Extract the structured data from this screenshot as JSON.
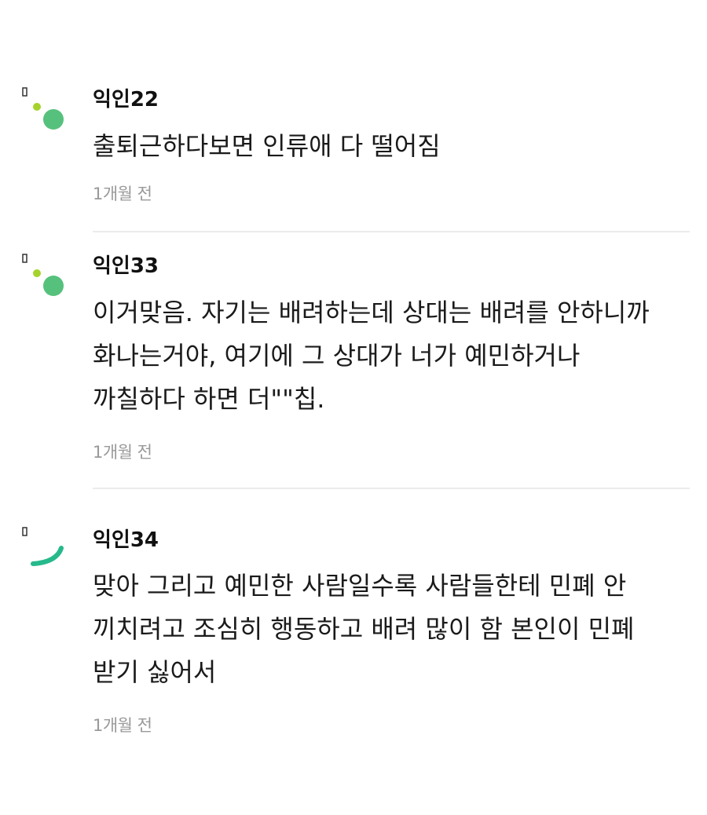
{
  "comments": [
    {
      "author": "익인22",
      "text": "출퇴근하다보면 인류애 다 떨어짐",
      "time": "1개월 전"
    },
    {
      "author": "익인33",
      "text": "이거맞음. 자기는 배려하는데 상대는 배려를 안하니까 화나는거야, 여기에 그 상대가 너가 예민하거나 까칠하다 하면 더\"\"칩.",
      "time": "1개월 전"
    },
    {
      "author": "익인34",
      "text": "맞아 그리고 예민한 사람일수록 사람들한테 민폐 안 끼치려고 조심히 행동하고 배려 많이 함 본인이 민폐 받기 싫어서",
      "time": "1개월 전"
    }
  ],
  "colors": {
    "dot_small": "#a6d32b",
    "dot_large": "#56c17c",
    "arc": "#26b98b",
    "tag": "#333333",
    "time": "#999999",
    "divider": "#ececec"
  },
  "icons": {
    "avatar_dots": "anonymous-avatar-dots-icon",
    "avatar_arc": "anonymous-avatar-arc-icon"
  }
}
